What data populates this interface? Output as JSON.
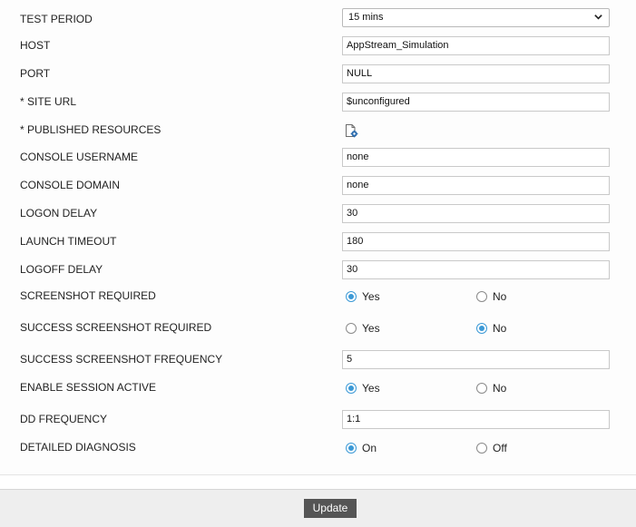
{
  "fields": {
    "test_period": {
      "label": "TEST PERIOD",
      "value": "15 mins"
    },
    "host": {
      "label": "HOST",
      "value": "AppStream_Simulation"
    },
    "port": {
      "label": "PORT",
      "value": "NULL"
    },
    "site_url": {
      "label": "* SITE URL",
      "value": "$unconfigured"
    },
    "published_resources": {
      "label": "* PUBLISHED RESOURCES",
      "icon": "resource-settings-icon"
    },
    "console_username": {
      "label": "CONSOLE USERNAME",
      "value": "none"
    },
    "console_domain": {
      "label": "CONSOLE DOMAIN",
      "value": "none"
    },
    "logon_delay": {
      "label": "LOGON DELAY",
      "value": "30"
    },
    "launch_timeout": {
      "label": "LAUNCH TIMEOUT",
      "value": "180"
    },
    "logoff_delay": {
      "label": "LOGOFF DELAY",
      "value": "30"
    },
    "screenshot_required": {
      "label": "SCREENSHOT REQUIRED",
      "option_yes": "Yes",
      "option_no": "No",
      "selected": "Yes"
    },
    "success_screenshot_required": {
      "label": "SUCCESS SCREENSHOT REQUIRED",
      "option_yes": "Yes",
      "option_no": "No",
      "selected": "No"
    },
    "success_screenshot_frequency": {
      "label": "SUCCESS SCREENSHOT FREQUENCY",
      "value": "5"
    },
    "enable_session_active": {
      "label": "ENABLE SESSION ACTIVE",
      "option_yes": "Yes",
      "option_no": "No",
      "selected": "Yes"
    },
    "dd_frequency": {
      "label": "DD FREQUENCY",
      "value": "1:1"
    },
    "detailed_diagnosis": {
      "label": "DETAILED DIAGNOSIS",
      "option_on": "On",
      "option_off": "Off",
      "selected": "On"
    }
  },
  "footer": {
    "update_label": "Update"
  },
  "colors": {
    "radio_accent": "#3b99d6",
    "button_bg": "#555555",
    "footer_bg": "#eeeeee"
  }
}
